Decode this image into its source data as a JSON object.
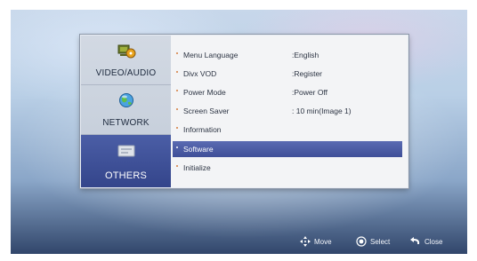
{
  "sidebar": {
    "items": [
      {
        "label": "VIDEO/AUDIO",
        "icon": "video-audio-icon"
      },
      {
        "label": "NETWORK",
        "icon": "network-globe-icon"
      },
      {
        "label": "OTHERS",
        "icon": "others-box-icon"
      }
    ]
  },
  "settings": [
    {
      "name": "Menu Language",
      "value": ":English"
    },
    {
      "name": "Divx VOD",
      "value": ":Register"
    },
    {
      "name": "Power Mode",
      "value": ":Power Off"
    },
    {
      "name": "Screen Saver",
      "value": ": 10 min(Image 1)"
    },
    {
      "name": "Information",
      "value": ""
    },
    {
      "name": "Software",
      "value": ""
    },
    {
      "name": "Initialize",
      "value": ""
    }
  ],
  "footer": {
    "move": "Move",
    "select": "Select",
    "close": "Close"
  },
  "colors": {
    "selected_background": "#4b5ea6",
    "bullet": "#d57a3a"
  }
}
